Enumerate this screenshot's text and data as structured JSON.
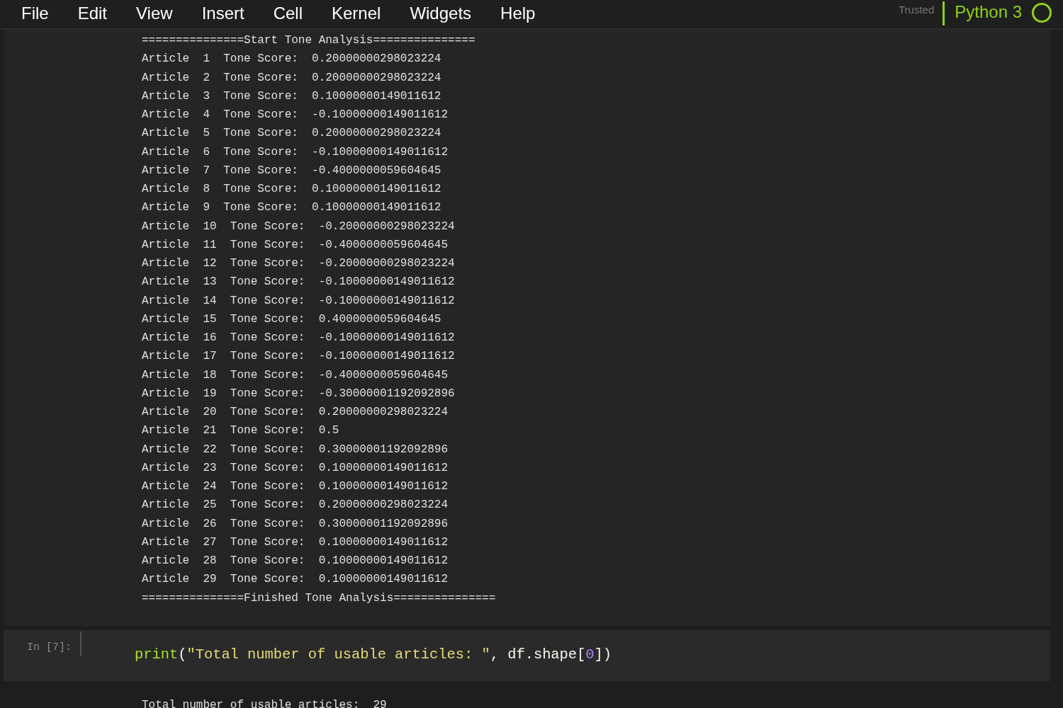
{
  "menu": [
    "File",
    "Edit",
    "View",
    "Insert",
    "Cell",
    "Kernel",
    "Widgets",
    "Help"
  ],
  "trusted": "Trusted",
  "kernel": {
    "name": "Python 3",
    "busy": false
  },
  "output_lines": [
    "===============Start Tone Analysis===============",
    "Article  1  Tone Score:  0.20000000298023224",
    "Article  2  Tone Score:  0.20000000298023224",
    "Article  3  Tone Score:  0.10000000149011612",
    "Article  4  Tone Score:  -0.10000000149011612",
    "Article  5  Tone Score:  0.20000000298023224",
    "Article  6  Tone Score:  -0.10000000149011612",
    "Article  7  Tone Score:  -0.4000000059604645",
    "Article  8  Tone Score:  0.10000000149011612",
    "Article  9  Tone Score:  0.10000000149011612",
    "Article  10  Tone Score:  -0.20000000298023224",
    "Article  11  Tone Score:  -0.4000000059604645",
    "Article  12  Tone Score:  -0.20000000298023224",
    "Article  13  Tone Score:  -0.10000000149011612",
    "Article  14  Tone Score:  -0.10000000149011612",
    "Article  15  Tone Score:  0.4000000059604645",
    "Article  16  Tone Score:  -0.10000000149011612",
    "Article  17  Tone Score:  -0.10000000149011612",
    "Article  18  Tone Score:  -0.4000000059604645",
    "Article  19  Tone Score:  -0.30000001192092896",
    "Article  20  Tone Score:  0.20000000298023224",
    "Article  21  Tone Score:  0.5",
    "Article  22  Tone Score:  0.30000001192092896",
    "Article  23  Tone Score:  0.10000000149011612",
    "Article  24  Tone Score:  0.10000000149011612",
    "Article  25  Tone Score:  0.20000000298023224",
    "Article  26  Tone Score:  0.30000001192092896",
    "Article  27  Tone Score:  0.10000000149011612",
    "Article  28  Tone Score:  0.10000000149011612",
    "Article  29  Tone Score:  0.10000000149011612",
    "===============Finished Tone Analysis==============="
  ],
  "cell": {
    "prompt": "In [7]:",
    "code": [
      {
        "kind": "builtin",
        "text": "print"
      },
      {
        "kind": "punct",
        "text": "("
      },
      {
        "kind": "string",
        "text": "\"Total number of usable articles: \""
      },
      {
        "kind": "punct",
        "text": ", df.shape["
      },
      {
        "kind": "number",
        "text": "0"
      },
      {
        "kind": "punct",
        "text": "])"
      }
    ],
    "output": "Total number of usable articles:  29"
  }
}
